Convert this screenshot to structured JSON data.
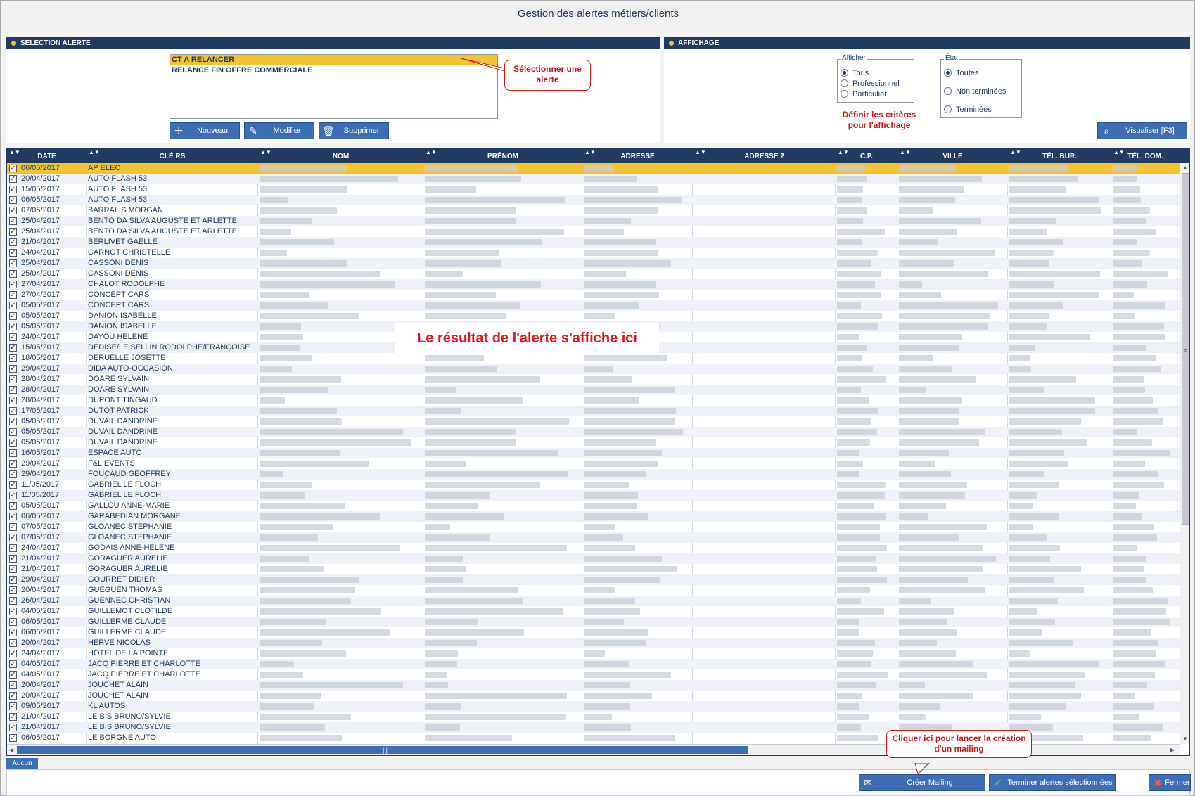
{
  "title": "Gestion des alertes métiers/clients",
  "selection": {
    "header": "SÉLECTION ALERTE",
    "alerts": [
      "CT A RELANCER",
      "RELANCE FIN OFFRE COMMERCIALE"
    ],
    "selected_index": 0,
    "buttons": {
      "new": "Nouveau",
      "edit": "Modifier",
      "delete": "Supprimer"
    },
    "callout": "Sélectionner une alerte"
  },
  "display": {
    "header": "AFFICHAGE",
    "show_group": {
      "legend": "Afficher",
      "options": [
        "Tous",
        "Professionnel",
        "Particulier"
      ],
      "selected": "Tous"
    },
    "state_group": {
      "legend": "État",
      "options": [
        "Toutes",
        "Non terminées",
        "Terminées"
      ],
      "selected": "Toutes"
    },
    "hint": "Définir les critères pour l'affichage",
    "view_button": "Visualiser [F3]"
  },
  "grid": {
    "columns": [
      "DATE",
      "CLÉ RS",
      "NOM",
      "PRÉNOM",
      "ADRESSE",
      "ADRESSE 2",
      "C.P.",
      "VILLE",
      "TÉL. BUR.",
      "TÉL. DOM."
    ],
    "rows": [
      {
        "date": "06/05/2017",
        "key": "AP ELEC"
      },
      {
        "date": "20/04/2017",
        "key": "AUTO FLASH 53"
      },
      {
        "date": "15/05/2017",
        "key": "AUTO FLASH 53"
      },
      {
        "date": "06/05/2017",
        "key": "AUTO FLASH 53"
      },
      {
        "date": "07/05/2017",
        "key": "BARRALIS MORGAN"
      },
      {
        "date": "25/04/2017",
        "key": "BENTO DA SILVA  AUGUSTE ET ARLETTE"
      },
      {
        "date": "25/04/2017",
        "key": "BENTO DA SILVA  AUGUSTE ET ARLETTE"
      },
      {
        "date": "21/04/2017",
        "key": "BERLIVET GAELLE"
      },
      {
        "date": "24/04/2017",
        "key": "CARNOT CHRISTELLE"
      },
      {
        "date": "25/04/2017",
        "key": "CASSONI DENIS"
      },
      {
        "date": "25/04/2017",
        "key": "CASSONI DENIS"
      },
      {
        "date": "27/04/2017",
        "key": "CHALOT RODOLPHE"
      },
      {
        "date": "27/04/2017",
        "key": "CONCEPT CARS"
      },
      {
        "date": "05/05/2017",
        "key": "CONCEPT CARS"
      },
      {
        "date": "05/05/2017",
        "key": "DANION ISABELLE"
      },
      {
        "date": "05/05/2017",
        "key": "DANION ISABELLE"
      },
      {
        "date": "24/04/2017",
        "key": "DAYOU HELENE"
      },
      {
        "date": "15/05/2017",
        "key": "DEDISE/LE SELLIN RODOLPHE/FRANÇOISE"
      },
      {
        "date": "18/05/2017",
        "key": "DERUELLE JOSETTE"
      },
      {
        "date": "29/04/2017",
        "key": "DIDA AUTO-OCCASION"
      },
      {
        "date": "28/04/2017",
        "key": "DOARE SYLVAIN"
      },
      {
        "date": "28/04/2017",
        "key": "DOARE SYLVAIN"
      },
      {
        "date": "28/04/2017",
        "key": "DUPONT TINGAUD"
      },
      {
        "date": "17/05/2017",
        "key": "DUTOT PATRICK"
      },
      {
        "date": "05/05/2017",
        "key": "DUVAIL DANDRINE"
      },
      {
        "date": "05/05/2017",
        "key": "DUVAIL DANDRINE"
      },
      {
        "date": "05/05/2017",
        "key": "DUVAIL DANDRINE"
      },
      {
        "date": "16/05/2017",
        "key": "ESPACE AUTO"
      },
      {
        "date": "29/04/2017",
        "key": "F&L EVENTS"
      },
      {
        "date": "29/04/2017",
        "key": "FOUCAUD GEOFFREY"
      },
      {
        "date": "11/05/2017",
        "key": "GABRIEL LE FLOCH"
      },
      {
        "date": "11/05/2017",
        "key": "GABRIEL LE FLOCH"
      },
      {
        "date": "05/05/2017",
        "key": "GALLOU ANNE-MARIE"
      },
      {
        "date": "06/05/2017",
        "key": "GARABEDIAN MORGANE"
      },
      {
        "date": "07/05/2017",
        "key": "GLOANEC STEPHANIE"
      },
      {
        "date": "07/05/2017",
        "key": "GLOANEC STEPHANIE"
      },
      {
        "date": "24/04/2017",
        "key": "GODAIS ANNE-HELENE"
      },
      {
        "date": "21/04/2017",
        "key": "GORAGUER AURELIE"
      },
      {
        "date": "21/04/2017",
        "key": "GORAGUER AURELIE"
      },
      {
        "date": "29/04/2017",
        "key": "GOURRET DIDIER"
      },
      {
        "date": "20/04/2017",
        "key": "GUEGUEN THOMAS"
      },
      {
        "date": "26/04/2017",
        "key": "GUENNEC CHRISTIAN"
      },
      {
        "date": "04/05/2017",
        "key": "GUILLEMOT CLOTILDE"
      },
      {
        "date": "06/05/2017",
        "key": "GUILLERME  CLAUDE"
      },
      {
        "date": "06/05/2017",
        "key": "GUILLERME  CLAUDE"
      },
      {
        "date": "20/04/2017",
        "key": "HERVE NICOLAS"
      },
      {
        "date": "24/04/2017",
        "key": "HOTEL DE LA POINTE"
      },
      {
        "date": "04/05/2017",
        "key": "JACQ PIERRE ET CHARLOTTE"
      },
      {
        "date": "04/05/2017",
        "key": "JACQ PIERRE ET CHARLOTTE"
      },
      {
        "date": "20/04/2017",
        "key": "JOUCHET ALAIN"
      },
      {
        "date": "20/04/2017",
        "key": "JOUCHET ALAIN"
      },
      {
        "date": "09/05/2017",
        "key": "KL AUTOS"
      },
      {
        "date": "21/04/2017",
        "key": "LE BIS BRUNO/SYLVIE"
      },
      {
        "date": "21/04/2017",
        "key": "LE BIS BRUNO/SYLVIE"
      },
      {
        "date": "06/05/2017",
        "key": "LE BORGNE  AUTO"
      }
    ],
    "overlay_label": "Le résultat de l'alerte s'affiche ici"
  },
  "status_tab": "Aucun",
  "footer": {
    "mailing_callout": "Cliquer ici pour lancer la création d'un mailing",
    "create_mailing": "Créer Mailing",
    "finish_alerts": "Terminer alertes sélectionnées",
    "close": "Fermer"
  },
  "colors": {
    "accent": "#1f3a63",
    "button": "#3d6db5",
    "selection": "#f4c430",
    "callout": "#cc1a1a"
  }
}
